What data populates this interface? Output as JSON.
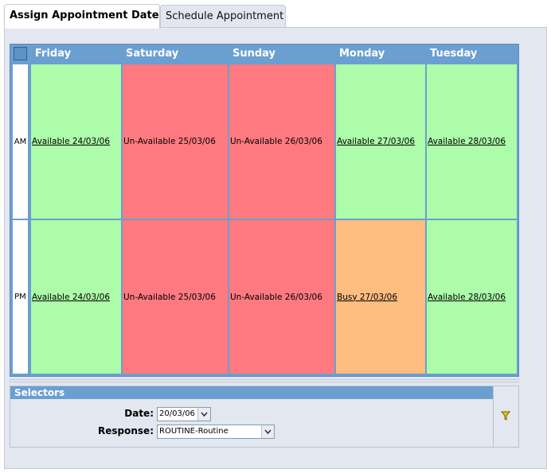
{
  "tabs": [
    {
      "label": "Assign Appointment Date",
      "active": true
    },
    {
      "label": "Schedule Appointment",
      "active": false
    }
  ],
  "calendar": {
    "days": [
      "Friday",
      "Saturday",
      "Sunday",
      "Monday",
      "Tuesday"
    ],
    "rows": [
      {
        "label": "AM",
        "slots": [
          {
            "status": "available",
            "text": "Available 24/03/06"
          },
          {
            "status": "unavailable",
            "text": "Un-Available 25/03/06"
          },
          {
            "status": "unavailable",
            "text": "Un-Available 26/03/06"
          },
          {
            "status": "available",
            "text": "Available 27/03/06"
          },
          {
            "status": "available",
            "text": "Available 28/03/06"
          }
        ]
      },
      {
        "label": "PM",
        "slots": [
          {
            "status": "available",
            "text": "Available 24/03/06"
          },
          {
            "status": "unavailable",
            "text": "Un-Available 25/03/06"
          },
          {
            "status": "unavailable",
            "text": "Un-Available 26/03/06"
          },
          {
            "status": "busy",
            "text": "Busy 27/03/06"
          },
          {
            "status": "available",
            "text": "Available 28/03/06"
          }
        ]
      }
    ],
    "colors": {
      "available": "#adfca9",
      "unavailable": "#ff7a80",
      "busy": "#ffbd80",
      "header": "#6b9fd0"
    }
  },
  "selectors": {
    "title": "Selectors",
    "date_label": "Date:",
    "date_value": "20/03/06",
    "response_label": "Response:",
    "response_value": "ROUTINE-Routine",
    "filter_icon": "filter-icon"
  }
}
